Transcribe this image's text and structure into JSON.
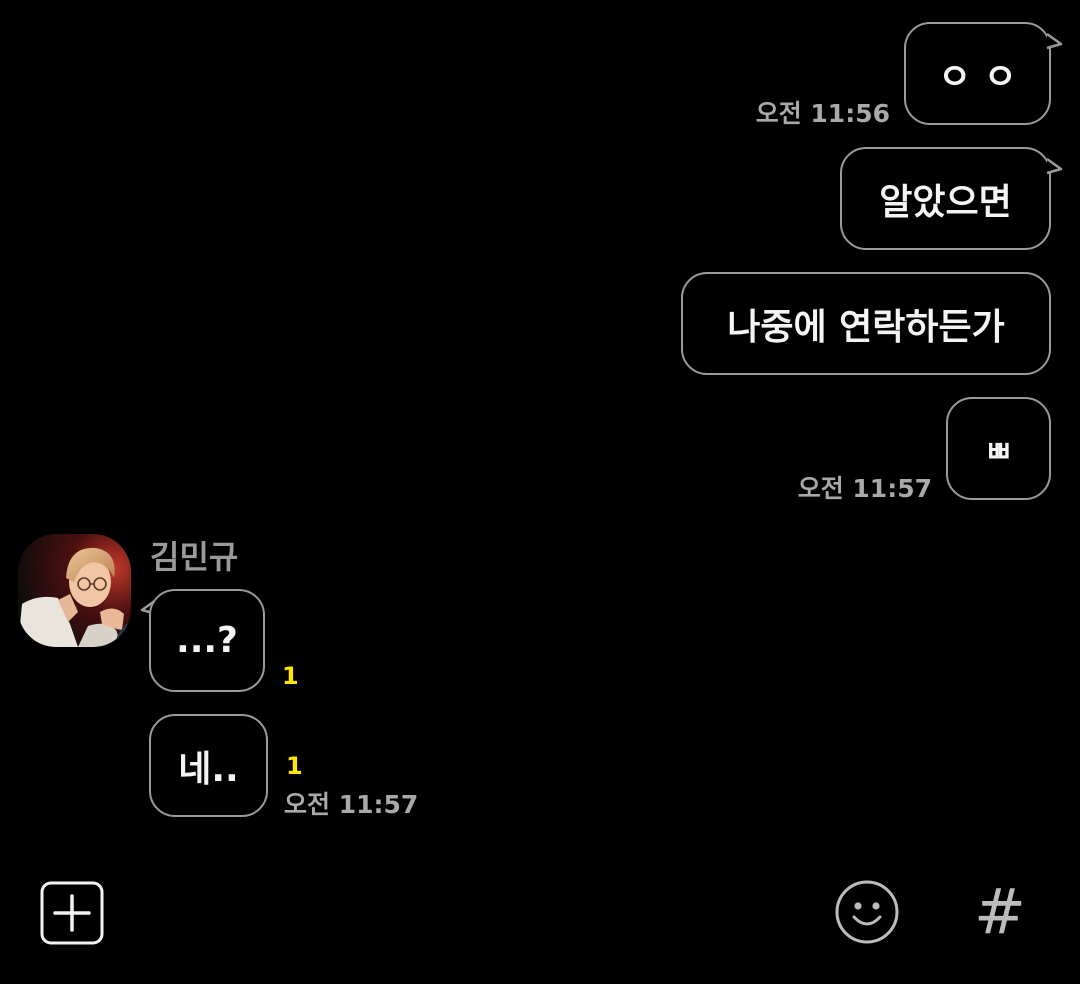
{
  "messages": {
    "sent": [
      {
        "text": "ㅇ ㅇ",
        "time": "오전 11:56"
      },
      {
        "text": "알았으면"
      },
      {
        "text": "나중에 연락하든가"
      },
      {
        "text": "ㅃ",
        "time": "오전 11:57"
      }
    ],
    "received": {
      "sender": "김민규",
      "items": [
        {
          "text": "...?",
          "unread": "1"
        },
        {
          "text": "네..",
          "unread": "1",
          "time": "오전 11:57"
        }
      ]
    }
  },
  "input_bar": {
    "plus_icon": "plus-square-icon",
    "emoji_icon": "smiley-icon",
    "hash_icon": "hashtag-icon",
    "hash_glyph": "#"
  },
  "colors": {
    "background": "#000000",
    "bubble_border": "#9a9a9a",
    "unread": "#ffe500",
    "timestamp": "#a9a9a9"
  }
}
